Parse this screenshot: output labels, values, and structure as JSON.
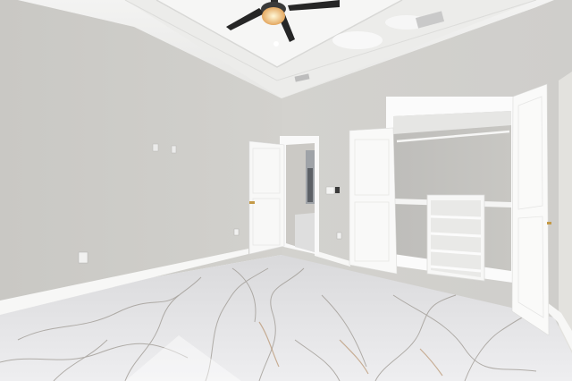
{
  "watermark": {
    "text": ""
  }
}
